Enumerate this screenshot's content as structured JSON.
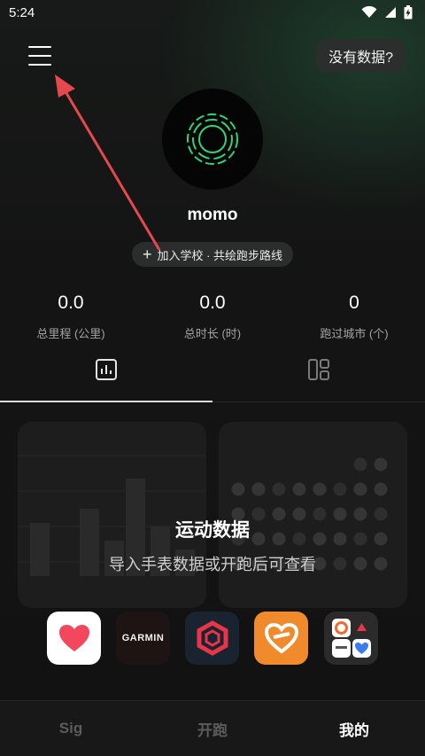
{
  "status_bar": {
    "time": "5:24"
  },
  "header": {
    "no_data_label": "没有数据?"
  },
  "profile": {
    "username": "momo",
    "join_label": "加入学校 · 共绘跑步路线"
  },
  "stats": [
    {
      "value": "0.0",
      "label": "总里程 (公里)"
    },
    {
      "value": "0.0",
      "label": "总时长 (时)"
    },
    {
      "value": "0",
      "label": "跑过城市 (个)"
    }
  ],
  "empty_state": {
    "title": "运动数据",
    "subtitle": "导入手表数据或开跑后可查看"
  },
  "apps": [
    {
      "name": "health",
      "icon": "heart-icon"
    },
    {
      "name": "garmin",
      "label": "GARMIN",
      "icon": "garmin-logo"
    },
    {
      "name": "coros",
      "icon": "hexagon-icon"
    },
    {
      "name": "huawei-health",
      "icon": "heart-outline-icon"
    },
    {
      "name": "more-apps",
      "icon": "app-grid-icon"
    }
  ],
  "bottom_nav": [
    {
      "label": "Sig",
      "active": false
    },
    {
      "label": "开跑",
      "active": false
    },
    {
      "label": "我的",
      "active": true
    }
  ],
  "colors": {
    "background": "#141414",
    "accent_green": "#2fd37a",
    "annotation_arrow": "#e5484d"
  }
}
